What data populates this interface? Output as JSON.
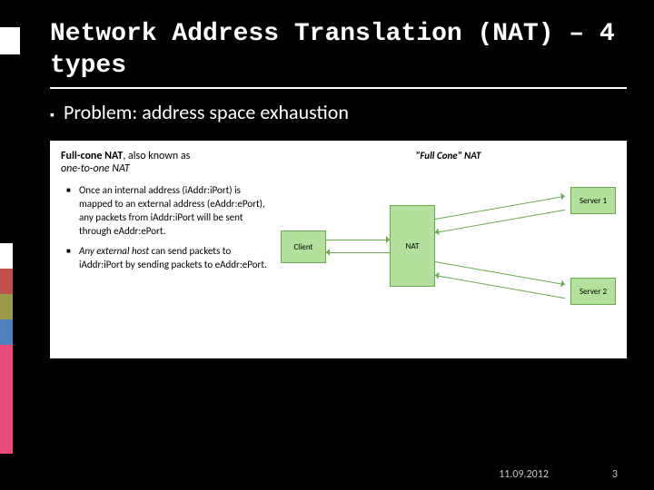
{
  "title": "Network Address Translation (NAT) – 4 types",
  "bullet": "Problem: address space exhaustion",
  "card": {
    "head_bold": "Full-cone NAT",
    "head_rest": ", also known as",
    "head_em": "one-to-one NAT",
    "items": [
      "Once an internal address (iAddr:iPort) is mapped to an external address (eAddr:ePort), any packets from iAddr:iPort will be sent through eAddr:ePort.",
      "<em>Any external host</em> can send packets to iAddr:iPort by sending packets to eAddr:ePort."
    ]
  },
  "diagram": {
    "title": "\"Full Cone\" NAT",
    "client": "Client",
    "nat": "NAT",
    "server1": "Server 1",
    "server2": "Server 2"
  },
  "footer": {
    "date": "11.09.2012",
    "page": "3"
  }
}
